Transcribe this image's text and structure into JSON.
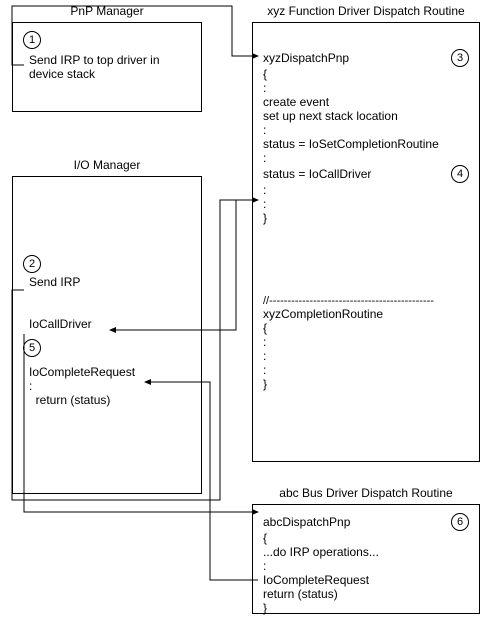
{
  "pnp": {
    "title": "PnP Manager",
    "num": "1",
    "text": "Send IRP to top driver in device stack"
  },
  "io": {
    "title": "I/O Manager",
    "num2": "2",
    "sendirp": "Send IRP",
    "iocall": "IoCallDriver",
    "num5": "5",
    "iocomp": "IoCompleteRequest",
    "dots": ":",
    "return": "  return (status)"
  },
  "func": {
    "title": "xyz Function Driver Dispatch Routine",
    "num3": "3",
    "l1": "xyzDispatchPnp",
    "l2": "{",
    "l3": ":",
    "l4": "create event",
    "l5": "set up next stack location",
    "l6": ":",
    "l7": "status = IoSetCompletionRoutine",
    "l8": ":",
    "l9": "status = IoCallDriver",
    "num4": "4",
    "l10": ":",
    "l11": ":",
    "l12": "}",
    "sep": "//---------------------------------------------",
    "c1": "xyzCompletionRoutine",
    "c2": "{",
    "c3": ":",
    "c4": ":",
    "c5": ":",
    "c6": "}"
  },
  "bus": {
    "title": "abc Bus Driver Dispatch Routine",
    "num6": "6",
    "l1": "abcDispatchPnp",
    "l2": "{",
    "l3": "...do IRP operations...",
    "l4": ":",
    "l5": "IoCompleteRequest",
    "l6": "return (status)",
    "l7": "}"
  }
}
